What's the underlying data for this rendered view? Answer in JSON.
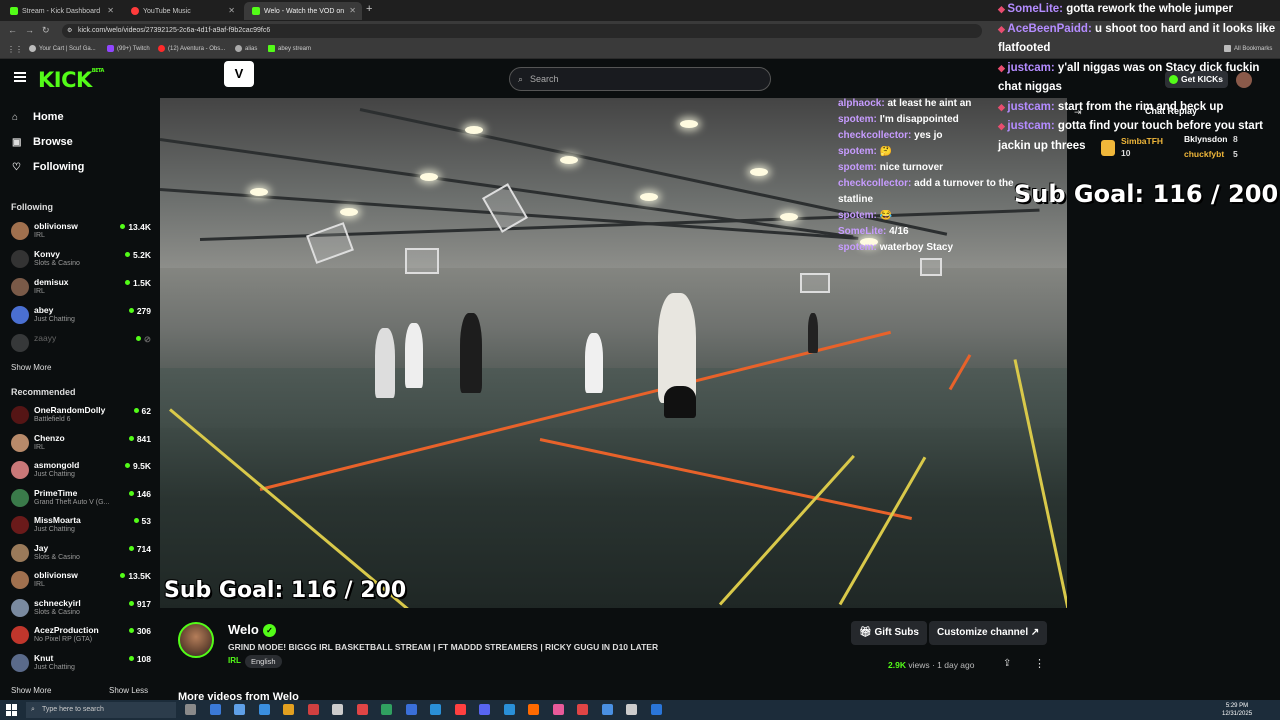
{
  "browser": {
    "tabs": [
      {
        "label": "Stream - Kick Dashboard",
        "color": "#53fc18",
        "active": false
      },
      {
        "label": "YouTube Music",
        "color": "#ff3b3b",
        "active": false
      },
      {
        "label": "Welo - Watch the VOD on ",
        "color": "#53fc18",
        "active": true
      }
    ],
    "url": "kick.com/welo/videos/27392125-2c6a-4d1f-a9af-f9b2cac99fc6",
    "bookmarks": [
      "Your Cart | Scuf Ga...",
      "(99+) Twitch",
      "(12) Aventura - Obs...",
      "alias",
      "abey stream"
    ],
    "all_bookmarks": "All Bookmarks"
  },
  "kick": {
    "logo": "KICK",
    "logo_badge": "BETA",
    "search_placeholder": "Search",
    "v_icon": "V"
  },
  "sidebar": {
    "nav": [
      {
        "label": "Home",
        "icon": "home-icon",
        "glyph": "⌂"
      },
      {
        "label": "Browse",
        "icon": "browse-icon",
        "glyph": "▣"
      },
      {
        "label": "Following",
        "icon": "heart-icon",
        "glyph": "♡"
      }
    ],
    "following_header": "Following",
    "following": [
      {
        "name": "oblivionsw",
        "category": "IRL",
        "viewers": "13.4K",
        "color": "#a0704e"
      },
      {
        "name": "Konvy",
        "category": "Slots & Casino",
        "viewers": "5.2K",
        "color": "#333333"
      },
      {
        "name": "demisux",
        "category": "IRL",
        "viewers": "1.5K",
        "color": "#7a5a48"
      },
      {
        "name": "abey",
        "category": "Just Chatting",
        "viewers": "279",
        "color": "#4a6fd1"
      },
      {
        "name": "zaayy",
        "category": "",
        "viewers": "",
        "color": "#777777",
        "offline": true
      }
    ],
    "show_more": "Show More",
    "recommended_header": "Recommended",
    "recommended": [
      {
        "name": "OneRandomDolly",
        "category": "Battlefield 6",
        "viewers": "62",
        "color": "#551515"
      },
      {
        "name": "Chenzo",
        "category": "IRL",
        "viewers": "841",
        "color": "#b88a6a"
      },
      {
        "name": "asmongold",
        "category": "Just Chatting",
        "viewers": "9.5K",
        "color": "#c97878"
      },
      {
        "name": "PrimeTime",
        "category": "Grand Theft Auto V (G...",
        "viewers": "146",
        "color": "#3a7a4a"
      },
      {
        "name": "MissMoarta",
        "category": "Just Chatting",
        "viewers": "53",
        "color": "#6a1a1a"
      },
      {
        "name": "Jay",
        "category": "Slots & Casino",
        "viewers": "714",
        "color": "#9a7a5a"
      },
      {
        "name": "oblivionsw",
        "category": "IRL",
        "viewers": "13.5K",
        "color": "#a0704e"
      },
      {
        "name": "schneckyirl",
        "category": "Slots & Casino",
        "viewers": "917",
        "color": "#7a8aa0"
      },
      {
        "name": "AcezProduction",
        "category": "No Pixel RP (GTA)",
        "viewers": "306",
        "color": "#c0362c"
      },
      {
        "name": "Knut",
        "category": "Just Chatting",
        "viewers": "108",
        "color": "#5a6a8a"
      }
    ],
    "show_more_2": "Show More",
    "show_less": "Show Less"
  },
  "video": {
    "overlay_chat": [
      {
        "user": "alphaock:",
        "text": "at least he aint an"
      },
      {
        "user": "spotem:",
        "text": "I'm disappointed"
      },
      {
        "user": "checkcollector:",
        "text": "yes jo"
      },
      {
        "user": "spotem:",
        "text": "🤔"
      },
      {
        "user": "spotem:",
        "text": "nice turnover"
      },
      {
        "user": "checkcollector:",
        "text": "add a turnover to the"
      },
      {
        "user": "",
        "text": "statline"
      },
      {
        "user": "spotem:",
        "text": "😂"
      },
      {
        "user": "SomeLite:",
        "text": "4/16"
      },
      {
        "user": "spotem:",
        "text": "waterboy Stacy"
      }
    ],
    "sub_goal": "Sub Goal:  116 / 200"
  },
  "stream": {
    "streamer": "Welo",
    "title": "GRIND MODE! BIGGG IRL BASKETBALL STREAM | FT MADDD STREAMERS | RICKY GUGU IN D10 LATER",
    "category": "IRL",
    "language": "English",
    "gift_subs": "Gift Subs",
    "customize": "Customize channel",
    "views_count": "2.9K",
    "views_label": " views",
    "age": "1 day ago",
    "more_videos": "More videos from Welo"
  },
  "right_chat": [
    {
      "user": "SomeLite:",
      "text": "gotta rework the whole jumper"
    },
    {
      "user": "AceBeenPaidd:",
      "text": "u shoot too hard and it looks like flatfooted"
    },
    {
      "user": "justcam:",
      "text": "y'all niggas was on Stacy dick fuckin chat niggas"
    },
    {
      "user": "justcam:",
      "text": "start from the rim and beck up"
    },
    {
      "user": "justcam:",
      "text": "gotta find your touch before you start jackin up threes"
    }
  ],
  "right_panel": {
    "chat_replay": "Chat Replay",
    "get_kicks": "Get KICKs",
    "gifters": [
      {
        "name": "SimbaTFH",
        "count": "10",
        "color": "#f0b73a"
      },
      {
        "name": "Bklynsdon",
        "count": "8",
        "color": "#ffffff"
      },
      {
        "name": "chuckfybt",
        "count": "5",
        "color": "#f0b73a"
      }
    ],
    "sub_goal": "Sub Goal:  116 / 200"
  },
  "taskbar": {
    "search": "Type here to search",
    "time": "5:29 PM",
    "date": "12/31/2025"
  }
}
